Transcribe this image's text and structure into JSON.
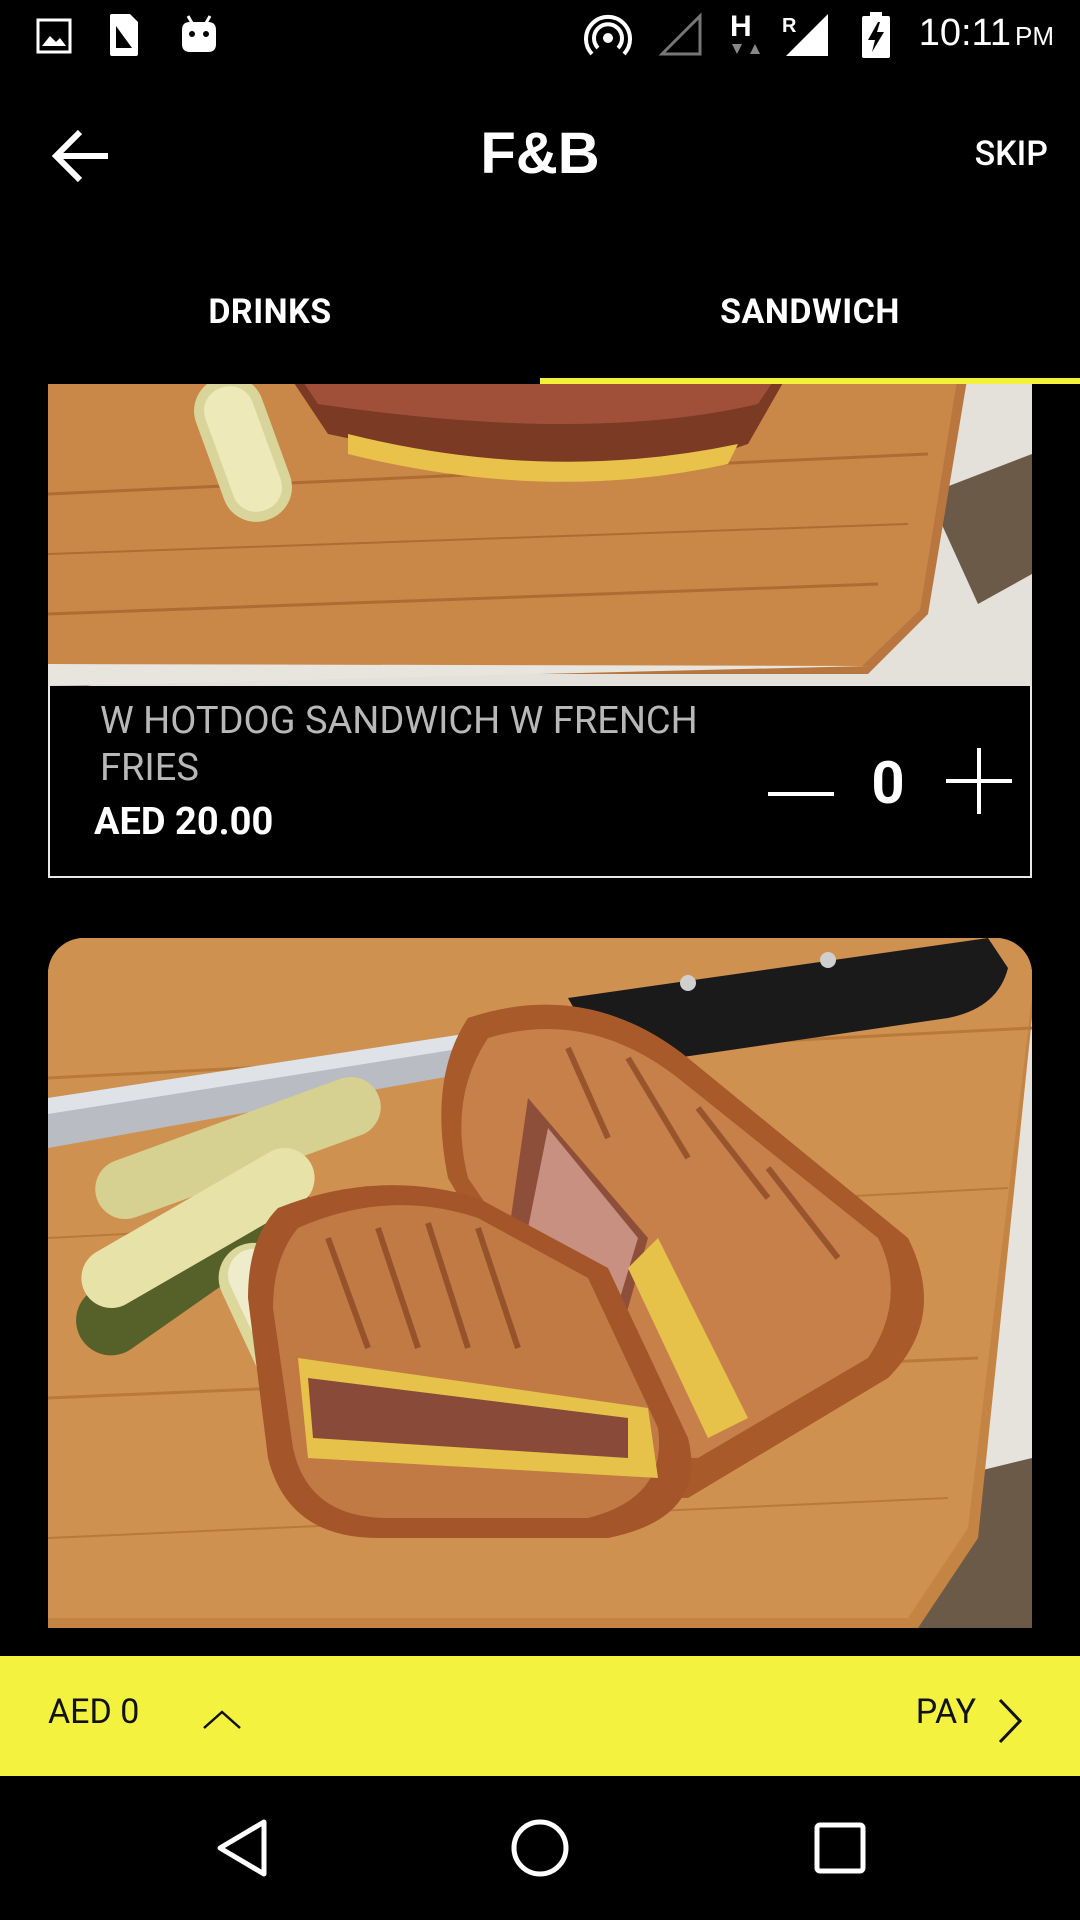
{
  "status_bar": {
    "time": "10:11",
    "ampm": "PM",
    "icons": [
      "image-icon",
      "sim-card-icon",
      "android-icon",
      "hotspot-icon",
      "no-signal-icon",
      "h-data-icon",
      "roaming-signal-icon",
      "battery-charging-icon"
    ]
  },
  "app_bar": {
    "title": "F&B",
    "skip_label": "SKIP"
  },
  "tabs": [
    {
      "label": "DRINKS",
      "selected": false
    },
    {
      "label": "SANDWICH",
      "selected": true
    }
  ],
  "accent_color": "#f2f23a",
  "items": [
    {
      "name": "W HOTDOG SANDWICH W FRENCH FRIES",
      "price": "AED 20.00",
      "quantity": "0"
    }
  ],
  "cart": {
    "total_label": "AED 0",
    "pay_label": "PAY"
  },
  "nav_bar": {
    "icons": [
      "back-triangle-icon",
      "home-circle-icon",
      "recents-square-icon"
    ]
  }
}
